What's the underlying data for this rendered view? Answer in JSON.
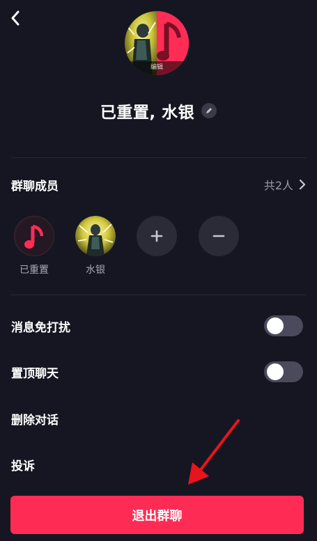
{
  "header": {
    "back_icon": "chevron-left-icon"
  },
  "group": {
    "edit_label": "编辑",
    "title": "已重置, 水银",
    "edit_name_icon": "pencil-icon"
  },
  "members": {
    "title": "群聊成员",
    "count": "共2人",
    "list": [
      {
        "name": "已重置",
        "avatar": "music-note-avatar"
      },
      {
        "name": "水银",
        "avatar": "anime-character-avatar"
      }
    ],
    "add_icon": "plus-icon",
    "remove_icon": "minus-icon"
  },
  "settings": {
    "mute_label": "消息免打扰",
    "mute_on": false,
    "pin_label": "置顶聊天",
    "pin_on": false,
    "delete_label": "删除对话",
    "report_label": "投诉"
  },
  "actions": {
    "exit_label": "退出群聊"
  },
  "colors": {
    "background": "#161622",
    "accent": "#fe2c55",
    "toggle_off": "#4a4a5c",
    "muted_text": "#9a9aa6",
    "annotation_arrow": "#e8141c"
  }
}
